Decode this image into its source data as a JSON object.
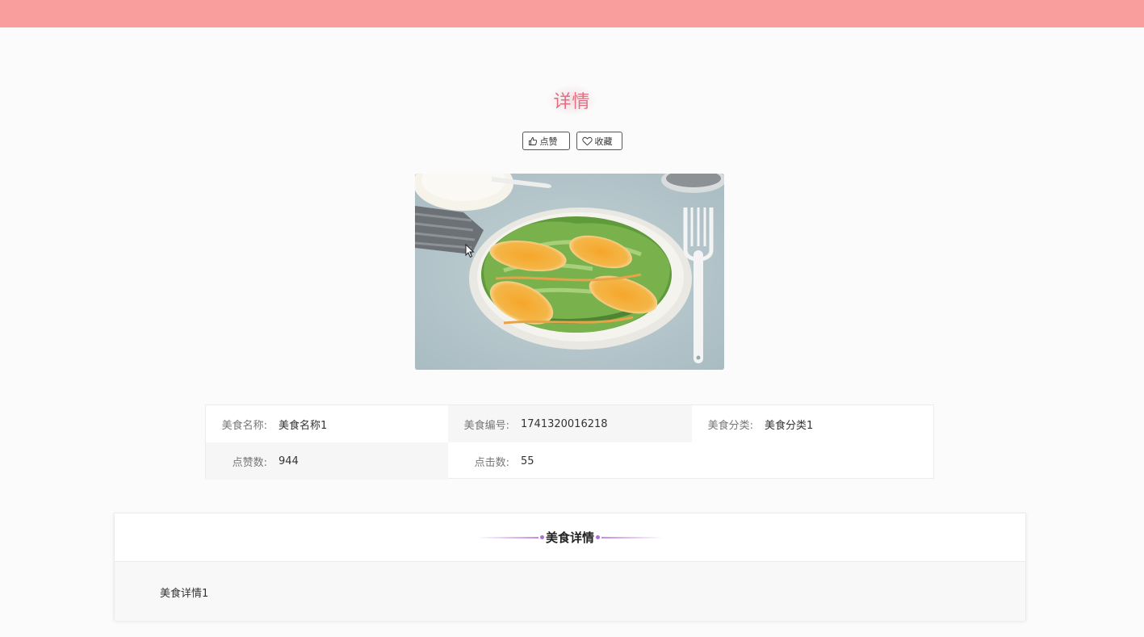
{
  "header": {
    "bar_color": "#f99d9d"
  },
  "page": {
    "title": "详情",
    "title_color": "#e07082"
  },
  "actions": {
    "like_label": "点赞",
    "favorite_label": "收藏",
    "like_icon": "thumbs-up-icon",
    "favorite_icon": "heart-icon"
  },
  "image": {
    "description_icon": "food-salad-photo"
  },
  "info": {
    "name_label": "美食名称:",
    "name_value": "美食名称1",
    "code_label": "美食编号:",
    "code_value": "1741320016218",
    "category_label": "美食分类:",
    "category_value": "美食分类1",
    "likes_label": "点赞数:",
    "likes_value": "944",
    "clicks_label": "点击数:",
    "clicks_value": "55"
  },
  "detail": {
    "section_title": "美食详情",
    "content": "美食详情1",
    "accent_color": "#b26cdc"
  }
}
